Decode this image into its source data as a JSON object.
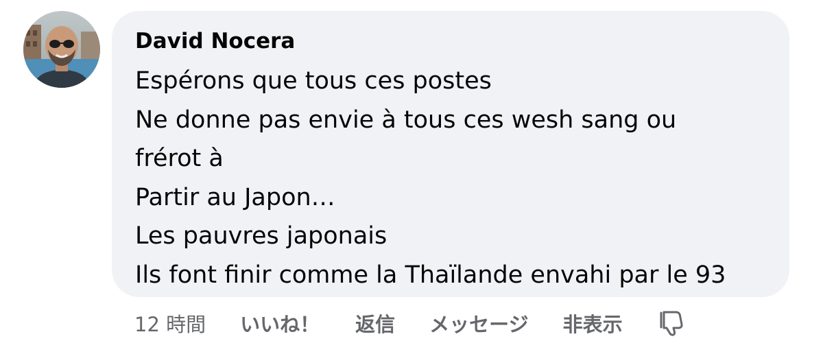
{
  "comment": {
    "author": "David Nocera",
    "lines": [
      "Espérons que tous ces postes",
      "Ne donne pas envie à tous ces wesh sang ou",
      "frérot à",
      "Partir au Japon…",
      "Les pauvres japonais",
      "Ils font finir comme la Thaïlande envahi par le 93"
    ]
  },
  "actions": {
    "time": "12 時間",
    "like": "いいね！",
    "reply": "返信",
    "message": "メッセージ",
    "hide": "非表示",
    "dislike_icon": "thumbs-down-icon"
  },
  "colors": {
    "bubble_background": "#f0f2f5",
    "text": "#050505",
    "secondary_text": "#65676b"
  }
}
